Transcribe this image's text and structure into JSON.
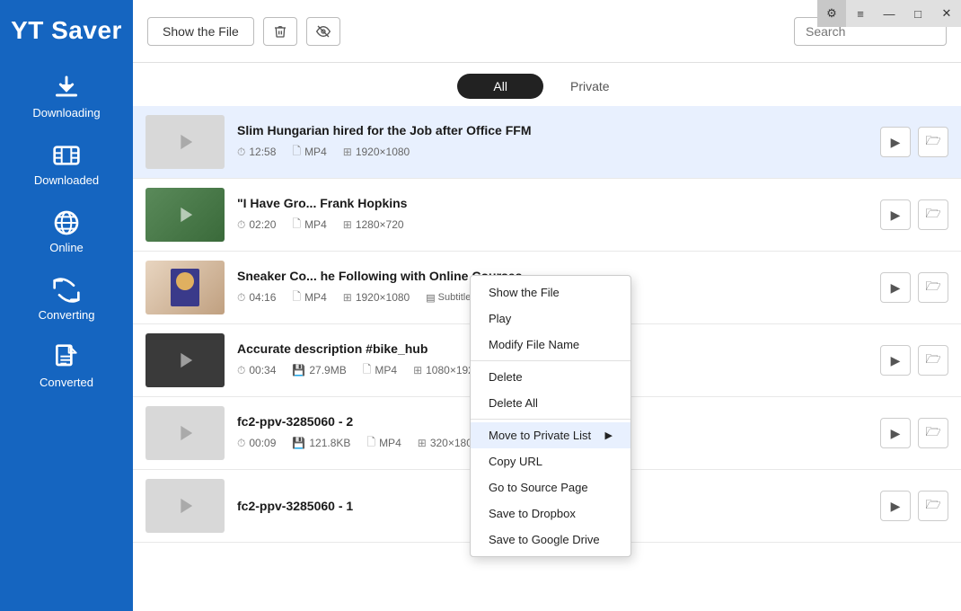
{
  "app": {
    "title": "YT Saver"
  },
  "sidebar": {
    "items": [
      {
        "id": "downloading",
        "label": "Downloading",
        "icon": "download"
      },
      {
        "id": "downloaded",
        "label": "Downloaded",
        "icon": "film"
      },
      {
        "id": "online",
        "label": "Online",
        "icon": "globe"
      },
      {
        "id": "converting",
        "label": "Converting",
        "icon": "convert"
      },
      {
        "id": "converted",
        "label": "Converted",
        "icon": "doc"
      }
    ]
  },
  "topbar": {
    "show_file_label": "Show the File",
    "search_placeholder": "Search"
  },
  "tabs": [
    {
      "id": "all",
      "label": "All"
    },
    {
      "id": "private",
      "label": "Private"
    }
  ],
  "window_controls": {
    "gear": "⚙",
    "menu": "≡",
    "minimize": "—",
    "maximize": "□",
    "close": "✕"
  },
  "list_items": [
    {
      "id": 1,
      "title": "Slim Hungarian hired for the Job after Office FFM",
      "duration": "12:58",
      "format": "MP4",
      "resolution": "1920×1080",
      "selected": true,
      "has_thumb": false
    },
    {
      "id": 2,
      "title": "\"I Have Gro... Frank Hopkins",
      "duration": "02:20",
      "format": "MP4",
      "resolution": "1280×720",
      "selected": false,
      "has_thumb": true,
      "thumb_type": "green"
    },
    {
      "id": 3,
      "title": "Sneaker Co... he Following with Online Courses",
      "duration": "04:16",
      "format": "MP4",
      "resolution": "1920×1080",
      "selected": false,
      "has_thumb": true,
      "thumb_type": "person",
      "has_subtitle": true,
      "subtitle_label": "Subtitle"
    },
    {
      "id": 4,
      "title": "Accurate description #bike_hub",
      "duration": "00:34",
      "size": "27.9MB",
      "format": "MP4",
      "resolution": "1080×1920",
      "selected": false,
      "has_thumb": true,
      "thumb_type": "bike"
    },
    {
      "id": 5,
      "title": "fc2-ppv-3285060 - 2",
      "duration": "00:09",
      "size": "121.8KB",
      "format": "MP4",
      "resolution": "320×180",
      "selected": false,
      "has_thumb": false
    },
    {
      "id": 6,
      "title": "fc2-ppv-3285060 - 1",
      "duration": "",
      "format": "",
      "resolution": "",
      "selected": false,
      "has_thumb": false
    }
  ],
  "context_menu": {
    "items": [
      {
        "id": "show-file",
        "label": "Show the File",
        "has_arrow": false
      },
      {
        "id": "play",
        "label": "Play",
        "has_arrow": false
      },
      {
        "id": "modify-name",
        "label": "Modify File Name",
        "has_arrow": false
      },
      {
        "separator": true
      },
      {
        "id": "delete",
        "label": "Delete",
        "has_arrow": false
      },
      {
        "id": "delete-all",
        "label": "Delete All",
        "has_arrow": false
      },
      {
        "separator": true
      },
      {
        "id": "move-private",
        "label": "Move to Private List",
        "has_arrow": true,
        "highlighted": true
      },
      {
        "id": "copy-url",
        "label": "Copy URL",
        "has_arrow": false
      },
      {
        "id": "go-source",
        "label": "Go to Source Page",
        "has_arrow": false
      },
      {
        "id": "save-dropbox",
        "label": "Save to Dropbox",
        "has_arrow": false
      },
      {
        "id": "save-gdrive",
        "label": "Save to Google Drive",
        "has_arrow": false
      }
    ]
  }
}
